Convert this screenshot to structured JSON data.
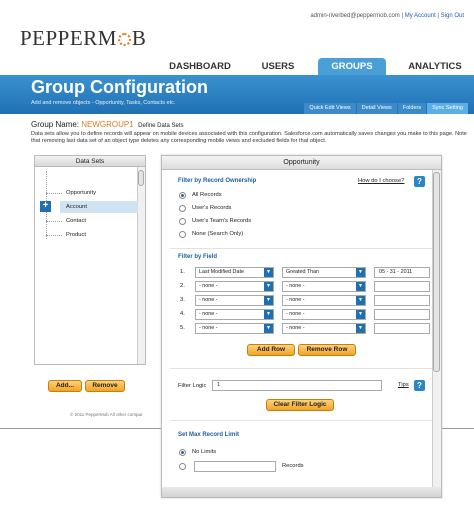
{
  "top_links": {
    "email": "admin-riverbed@peppermob.com",
    "sep1": " | ",
    "account": "My Account",
    "sep2": " | ",
    "signout": "Sign Out"
  },
  "logo": {
    "text_pre": "PEPPERM",
    "text_post": "B",
    "accent": "#e07a20"
  },
  "nav": {
    "tabs": [
      "DASHBOARD",
      "USERS",
      "GROUPS",
      "ANALYTICS"
    ],
    "active": "GROUPS"
  },
  "header": {
    "title": "Group Configuration",
    "subtitle": "Add and remove objects - Opportunity, Tasks, Contacts etc.",
    "subtabs": [
      "Quick Edit Views",
      "Detail Views",
      "Folders",
      "Sync Setting"
    ],
    "active_subtab": "Sync Setting"
  },
  "group": {
    "label": "Group Name:",
    "name": "NEWGROUP1",
    "action": "Define Data Sets"
  },
  "description": "Data sets allow you to define records will appear on mobile devices associated with this configuration. Salesforce.com automatically saves changes you make to this page. Note that removing last data set of an object type deletes any corresponding mobile views and excluded fields for that object.",
  "datasets": {
    "title": "Data Sets",
    "items": [
      "Opportunity",
      "Account",
      "Contact",
      "Product"
    ],
    "selected": "Account",
    "add_label": "Add...",
    "remove_label": "Remove"
  },
  "copyright": "© 2011 PepperMob All other compar",
  "opportunity": {
    "title": "Opportunity",
    "ownership": {
      "heading": "Filter by Record Ownership",
      "help_link": "How do I choose?",
      "options": [
        "All Records",
        "User's Records",
        "User's Team's Records",
        "None (Search Only)"
      ],
      "selected_index": 0
    },
    "field_filter": {
      "heading": "Filter by Field",
      "rows": [
        {
          "num": "1.",
          "field": "Last Modified Date",
          "op": "Greated Than",
          "value": "05 - 31 - 2011"
        },
        {
          "num": "2.",
          "field": "- none -",
          "op": "- none -",
          "value": ""
        },
        {
          "num": "3.",
          "field": "- none -",
          "op": "- none -",
          "value": ""
        },
        {
          "num": "4.",
          "field": "- none -",
          "op": "- none -",
          "value": ""
        },
        {
          "num": "5.",
          "field": "- none -",
          "op": "- none -",
          "value": ""
        }
      ],
      "add_row": "Add Row",
      "remove_row": "Remove Row"
    },
    "logic": {
      "label": "Filter Logic",
      "value": "1",
      "tips": "Tips",
      "clear": "Clear Filter Logic"
    },
    "max": {
      "heading": "Set Max Record Limit",
      "no_limits": "No Limits",
      "records_label": "Records",
      "selected_index": 0
    }
  }
}
